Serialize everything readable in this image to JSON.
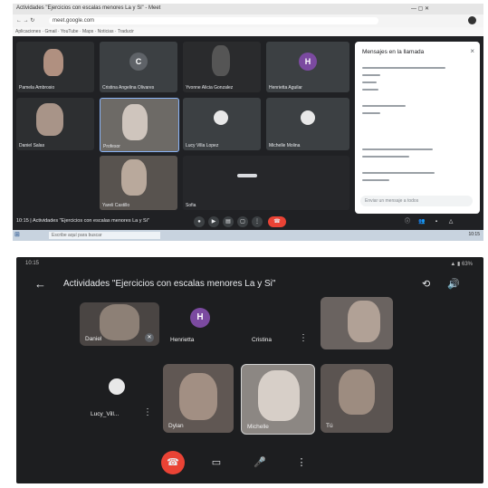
{
  "top": {
    "tab_title": "Actividades \"Ejercicios con escalas menores La y Si\" - Meet",
    "url": "meet.google.com",
    "bookmarks": "Aplicaciones  ·  Gmail  ·  YouTube  ·  Maps  ·  Noticias  ·  Traducir",
    "participants": [
      {
        "name": "Pamela Ambrosio"
      },
      {
        "name": "Cristina Angelina Olivares",
        "initial": "C"
      },
      {
        "name": "Yvonne Alicia Gonzalez",
        "initial": ""
      },
      {
        "name": "Henrietta Aguilar",
        "initial": "H"
      },
      {
        "name": "Daniel Salas"
      },
      {
        "name": "Profesor"
      },
      {
        "name": "Lucy Villa Lopez"
      },
      {
        "name": "Michelle Molina"
      },
      {
        "name": "Yareli Castillo"
      },
      {
        "name": "Sofia"
      }
    ],
    "panel": {
      "title": "Mensajes en la llamada",
      "close": "×",
      "input_placeholder": "Enviar un mensaje a todos"
    },
    "meeting_label": "10:15 | Actividades \"Ejercicios con escalas menores La y Si\"",
    "taskbar_search": "Escribe aquí para buscar",
    "taskbar_clock": "10:15"
  },
  "bottom": {
    "status_time": "10:15",
    "status_icons": "▲ ▮ 63%",
    "back": "←",
    "title": "Actividades \"Ejercicios con escalas menores La y Si\"",
    "participants": [
      {
        "name": "Daniel"
      },
      {
        "name": "Henrietta",
        "initial": "H"
      },
      {
        "name": "Cristina"
      },
      {
        "name": "Lucy_Vill..."
      },
      {
        "name": "Dylan"
      },
      {
        "name": "Michelle"
      },
      {
        "name": "Tú"
      }
    ],
    "more": "⋮",
    "controls": {
      "end_call": "☎",
      "camera": "▭",
      "mic": "🎤",
      "more": "⋮"
    },
    "colors": {
      "end_call": "#ea4335",
      "avatar_h": "#7b4aa0",
      "avatar_c": "#5f6368"
    }
  }
}
